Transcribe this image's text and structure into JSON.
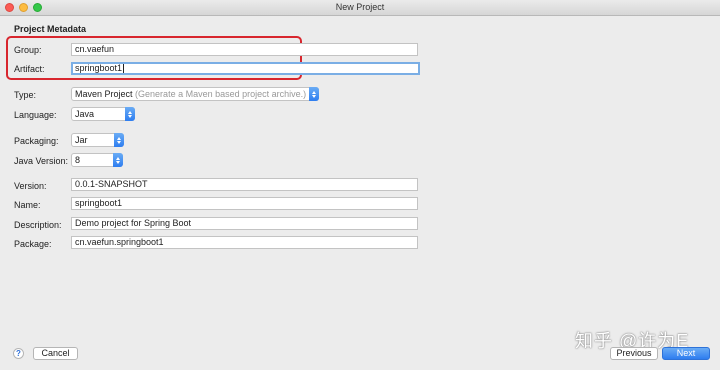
{
  "window": {
    "title": "New Project"
  },
  "section_title": "Project Metadata",
  "fields": {
    "group": {
      "label": "Group:",
      "value": "cn.vaefun"
    },
    "artifact": {
      "label": "Artifact:",
      "value": "springboot1"
    },
    "type": {
      "label": "Type:",
      "value": "Maven Project",
      "hint": "(Generate a Maven based project archive.)"
    },
    "language": {
      "label": "Language:",
      "value": "Java"
    },
    "packaging": {
      "label": "Packaging:",
      "value": "Jar"
    },
    "java_version": {
      "label": "Java Version:",
      "value": "8"
    },
    "version": {
      "label": "Version:",
      "value": "0.0.1-SNAPSHOT"
    },
    "name": {
      "label": "Name:",
      "value": "springboot1"
    },
    "description": {
      "label": "Description:",
      "value": "Demo project for Spring Boot"
    },
    "package": {
      "label": "Package:",
      "value": "cn.vaefun.springboot1"
    }
  },
  "footer": {
    "help": "?",
    "cancel": "Cancel",
    "previous": "Previous",
    "next": "Next"
  },
  "watermark": "知乎 @许为E",
  "colors": {
    "highlight_border": "#d8262e",
    "accent": "#2e7df0"
  }
}
